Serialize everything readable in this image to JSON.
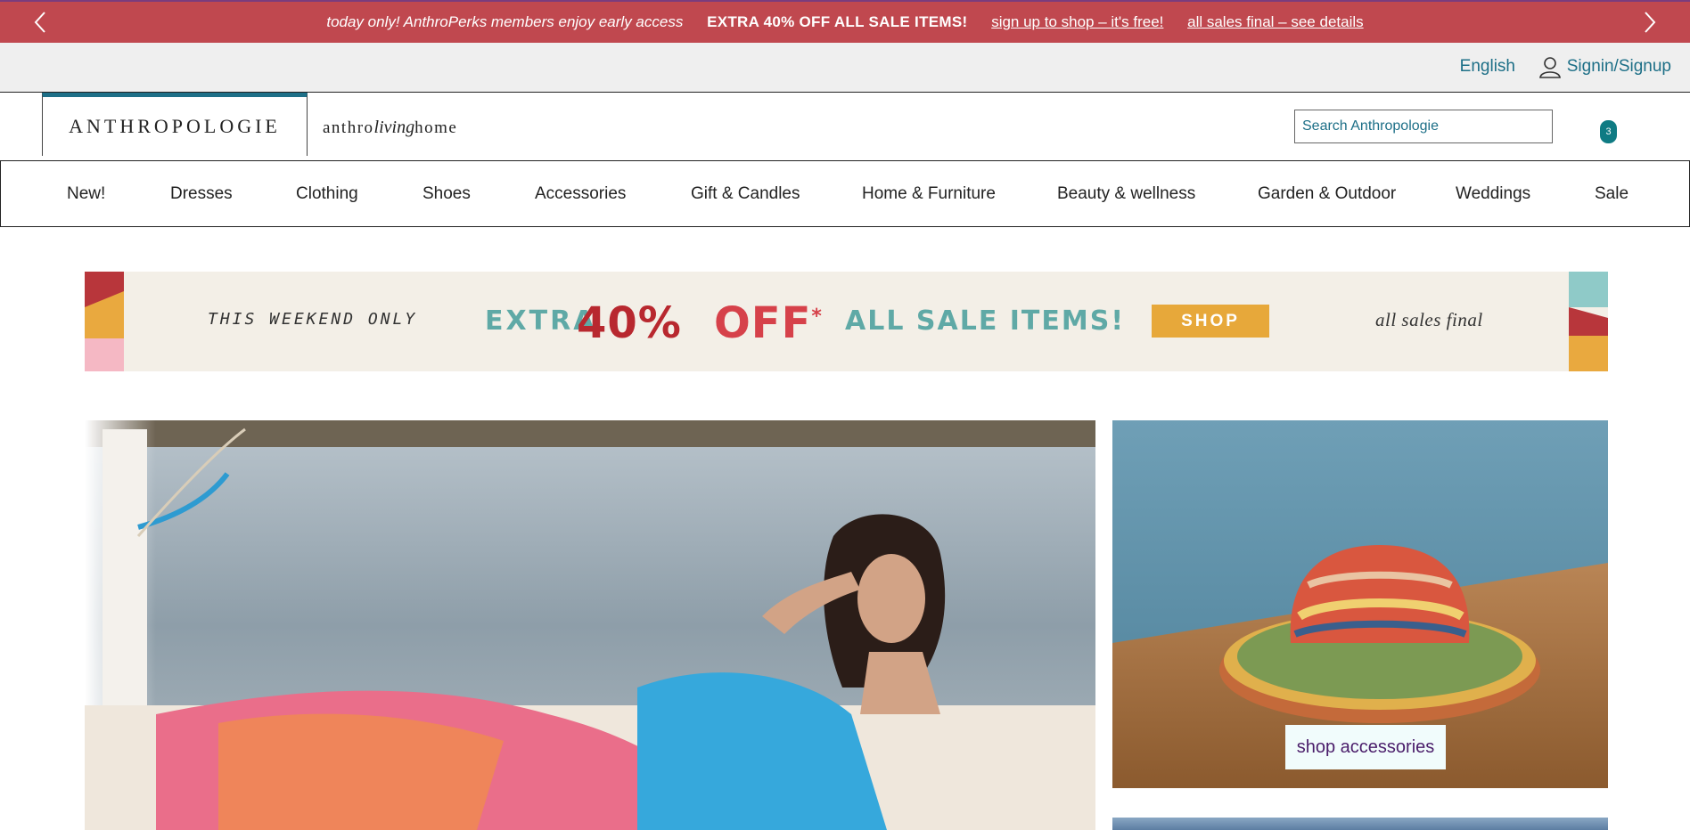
{
  "promo": {
    "message_1": "today only! AnthroPerks members enjoy early access",
    "message_2": "EXTRA 40% OFF ALL SALE ITEMS!",
    "link_1": "sign up to shop – it's free!",
    "link_2": "all sales final – see details"
  },
  "utility": {
    "language": "English",
    "signin": "Signin/Signup"
  },
  "header": {
    "logo": "ANTHROPOLOGIE",
    "living_logo_left": "anthro",
    "living_logo_script": "living",
    "living_logo_right": "home",
    "search_placeholder": "Search Anthropologie",
    "cart_count": "3"
  },
  "nav": {
    "items": [
      "New!",
      "Dresses",
      "Clothing",
      "Shoes",
      "Accessories",
      "Gift & Candles",
      "Home & Furniture",
      "Beauty & wellness",
      "Garden & Outdoor",
      "Weddings",
      "Sale"
    ]
  },
  "sale_banner": {
    "weekend": "THIS WEEKEND ONLY",
    "extra": "EXTRA",
    "percent": "40%",
    "off": "OFF",
    "asterisk": "*",
    "all_sale": "ALL SALE ITEMS!",
    "shop": "SHOP",
    "final": "all sales final"
  },
  "hero": {
    "side_cta": "shop accessories"
  },
  "colors": {
    "promo_bg": "#c0484f",
    "teal_link": "#1d6f87",
    "cart_badge": "#0f7b83",
    "banner_bg": "#f3efe7"
  }
}
